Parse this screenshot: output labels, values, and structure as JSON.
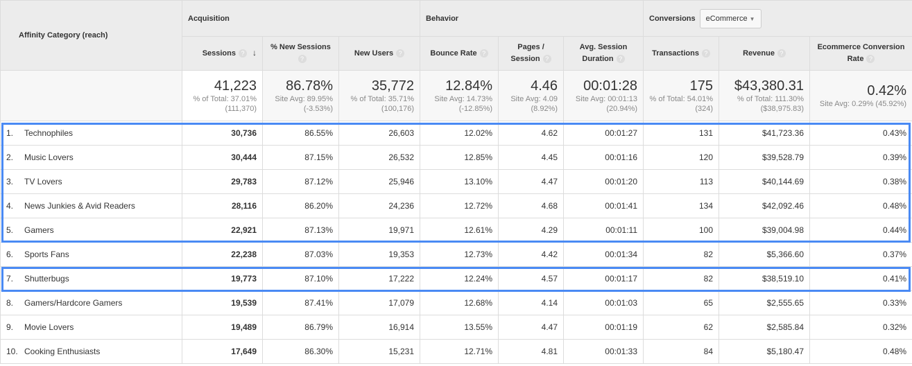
{
  "header": {
    "dimension": "Affinity Category (reach)",
    "groups": {
      "acquisition": "Acquisition",
      "behavior": "Behavior",
      "conversions": "Conversions"
    },
    "conversions_select": "eCommerce",
    "columns": [
      "Sessions",
      "% New Sessions",
      "New Users",
      "Bounce Rate",
      "Pages / Session",
      "Avg. Session Duration",
      "Transactions",
      "Revenue",
      "Ecommerce Conversion Rate"
    ],
    "help": "?"
  },
  "totals": [
    {
      "value": "41,223",
      "line1": "% of Total: 37.01%",
      "line2": "(111,370)"
    },
    {
      "value": "86.78%",
      "line1": "Site Avg: 89.95%",
      "line2": "(-3.53%)"
    },
    {
      "value": "35,772",
      "line1": "% of Total: 35.71%",
      "line2": "(100,176)"
    },
    {
      "value": "12.84%",
      "line1": "Site Avg: 14.73%",
      "line2": "(-12.85%)"
    },
    {
      "value": "4.46",
      "line1": "Site Avg: 4.09",
      "line2": "(8.92%)"
    },
    {
      "value": "00:01:28",
      "line1": "Site Avg: 00:01:13",
      "line2": "(20.94%)"
    },
    {
      "value": "175",
      "line1": "% of Total: 54.01%",
      "line2": "(324)"
    },
    {
      "value": "$43,380.31",
      "line1": "% of Total: 111.30%",
      "line2": "($38,975.83)"
    },
    {
      "value": "0.42%",
      "line1": "Site Avg: 0.29% (45.92%)",
      "line2": ""
    }
  ],
  "rows": [
    {
      "index": "1.",
      "name": "Technophiles",
      "cells": [
        "30,736",
        "86.55%",
        "26,603",
        "12.02%",
        "4.62",
        "00:01:27",
        "131",
        "$41,723.36",
        "0.43%"
      ]
    },
    {
      "index": "2.",
      "name": "Music Lovers",
      "cells": [
        "30,444",
        "87.15%",
        "26,532",
        "12.85%",
        "4.45",
        "00:01:16",
        "120",
        "$39,528.79",
        "0.39%"
      ]
    },
    {
      "index": "3.",
      "name": "TV Lovers",
      "cells": [
        "29,783",
        "87.12%",
        "25,946",
        "13.10%",
        "4.47",
        "00:01:20",
        "113",
        "$40,144.69",
        "0.38%"
      ]
    },
    {
      "index": "4.",
      "name": "News Junkies & Avid Readers",
      "cells": [
        "28,116",
        "86.20%",
        "24,236",
        "12.72%",
        "4.68",
        "00:01:41",
        "134",
        "$42,092.46",
        "0.48%"
      ]
    },
    {
      "index": "5.",
      "name": "Gamers",
      "cells": [
        "22,921",
        "87.13%",
        "19,971",
        "12.61%",
        "4.29",
        "00:01:11",
        "100",
        "$39,004.98",
        "0.44%"
      ]
    },
    {
      "index": "6.",
      "name": "Sports Fans",
      "cells": [
        "22,238",
        "87.03%",
        "19,353",
        "12.73%",
        "4.42",
        "00:01:34",
        "82",
        "$5,366.60",
        "0.37%"
      ]
    },
    {
      "index": "7.",
      "name": "Shutterbugs",
      "cells": [
        "19,773",
        "87.10%",
        "17,222",
        "12.24%",
        "4.57",
        "00:01:17",
        "82",
        "$38,519.10",
        "0.41%"
      ]
    },
    {
      "index": "8.",
      "name": "Gamers/Hardcore Gamers",
      "cells": [
        "19,539",
        "87.41%",
        "17,079",
        "12.68%",
        "4.14",
        "00:01:03",
        "65",
        "$2,555.65",
        "0.33%"
      ]
    },
    {
      "index": "9.",
      "name": "Movie Lovers",
      "cells": [
        "19,489",
        "86.79%",
        "16,914",
        "13.55%",
        "4.47",
        "00:01:19",
        "62",
        "$2,585.84",
        "0.32%"
      ]
    },
    {
      "index": "10.",
      "name": "Cooking Enthusiasts",
      "cells": [
        "17,649",
        "86.30%",
        "15,231",
        "12.71%",
        "4.81",
        "00:01:33",
        "84",
        "$5,180.47",
        "0.48%"
      ]
    }
  ],
  "highlight_color": "#4a8af4"
}
